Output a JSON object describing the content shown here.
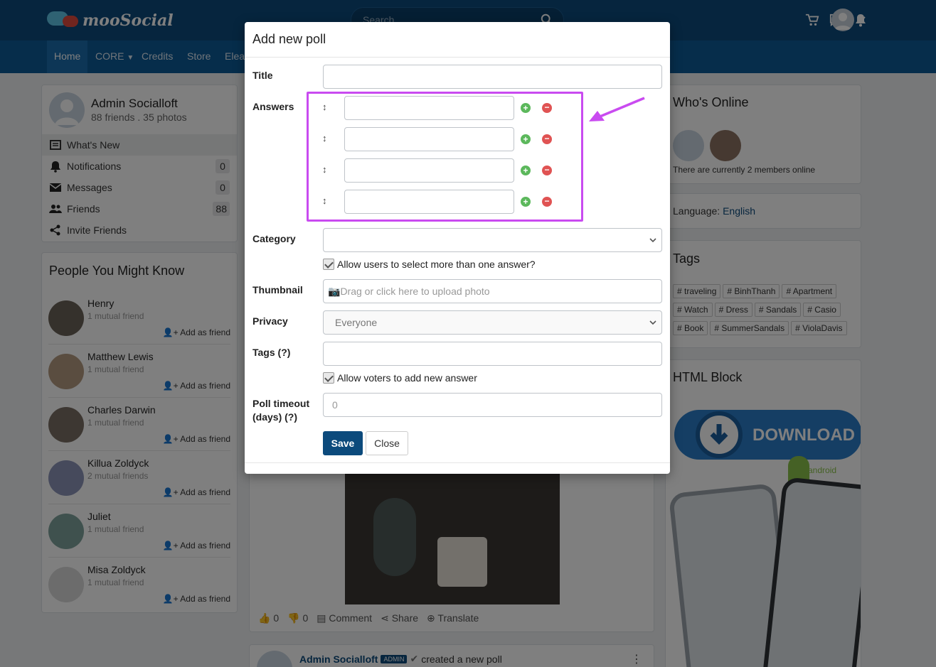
{
  "brand": {
    "name": "mooSocial"
  },
  "header": {
    "search_placeholder": "Search"
  },
  "nav": {
    "items": [
      "Home",
      "CORE",
      "Credits",
      "Store",
      "Elea"
    ]
  },
  "profile": {
    "name": "Admin Socialloft",
    "stats": "88 friends . 35 photos"
  },
  "menu": [
    {
      "label": "What's New",
      "count": ""
    },
    {
      "label": "Notifications",
      "count": "0"
    },
    {
      "label": "Messages",
      "count": "0"
    },
    {
      "label": "Friends",
      "count": "88"
    },
    {
      "label": "Invite Friends",
      "count": ""
    }
  ],
  "people": {
    "title": "People You Might Know",
    "add_label": "Add as friend",
    "list": [
      {
        "name": "Henry",
        "mutual": "1 mutual friend"
      },
      {
        "name": "Matthew Lewis",
        "mutual": "1 mutual friend"
      },
      {
        "name": "Charles Darwin",
        "mutual": "1 mutual friend"
      },
      {
        "name": "Killua Zoldyck",
        "mutual": "2 mutual friends"
      },
      {
        "name": "Juliet",
        "mutual": "1 mutual friend"
      },
      {
        "name": "Misa Zoldyck",
        "mutual": "1 mutual friend"
      }
    ]
  },
  "right": {
    "online_title": "Who's Online",
    "online_text": "There are currently 2 members online",
    "language_label": "Language:",
    "language_value": "English",
    "tags_title": "Tags",
    "tags": [
      "# traveling",
      "# BinhThanh",
      "# Apartment",
      "# Watch",
      "# Dress",
      "# Sandals",
      "# Casio",
      "# Book",
      "# SummerSandals",
      "# ViolaDavis"
    ],
    "html_block_title": "HTML Block",
    "download_label": "DOWNLOAD",
    "android_label": "android"
  },
  "feed": {
    "like_count": "0",
    "dislike_count": "0",
    "comment_label": "Comment",
    "share_label": "Share",
    "translate_label": "Translate",
    "post_author": "Admin Socialloft",
    "admin_badge": "ADMIN",
    "post_action": "created a new poll"
  },
  "modal": {
    "title": "Add new poll",
    "labels": {
      "title": "Title",
      "answers": "Answers",
      "category": "Category",
      "thumbnail": "Thumbnail",
      "privacy": "Privacy",
      "tags": "Tags  (?)",
      "timeout_line1": "Poll timeout",
      "timeout_line2": "(days)  (?)"
    },
    "multi_answer_label": "Allow users to select more than one answer?",
    "thumbnail_placeholder": "Drag or click here to upload photo",
    "privacy_value": "Everyone",
    "voters_add_label": "Allow voters to add new answer",
    "timeout_placeholder": "0",
    "save_label": "Save",
    "close_label": "Close",
    "answer_handle": "↕"
  },
  "colors": {
    "topbar": "#0c4a7c",
    "navbar": "#0d5a96",
    "highlight": "#c94bf0",
    "save_button": "#0c4a7c"
  }
}
